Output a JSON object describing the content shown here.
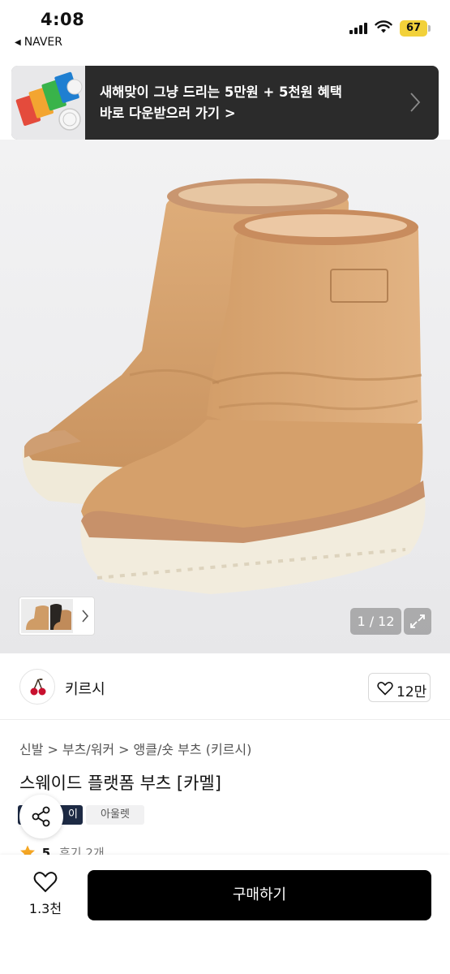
{
  "status_bar": {
    "time": "4:08",
    "back_app": "NAVER",
    "battery": "67"
  },
  "banner": {
    "line1": "새해맞이 그냥 드리는 5만원 + 5천원 혜택",
    "line2": "바로 다운받으러 가기 >"
  },
  "gallery": {
    "counter": "1 / 12"
  },
  "store": {
    "name": "키르시",
    "likes": "12만"
  },
  "product": {
    "breadcrumb": [
      "신발",
      "부츠/워커",
      "앵클/숏 부츠 (키르시)"
    ],
    "title": "스웨이드 플랫폼 부츠 [카멜]",
    "tag_pay": "이",
    "tag_outlet": "아울렛",
    "rating": "5",
    "reviews": "후기 2개"
  },
  "bottom_bar": {
    "wish_count": "1.3천",
    "buy_label": "구매하기"
  },
  "colors": {
    "accent_black": "#000000",
    "banner_bg": "#2b2b2b",
    "star": "#f5a623",
    "camel": "#d9a775"
  }
}
